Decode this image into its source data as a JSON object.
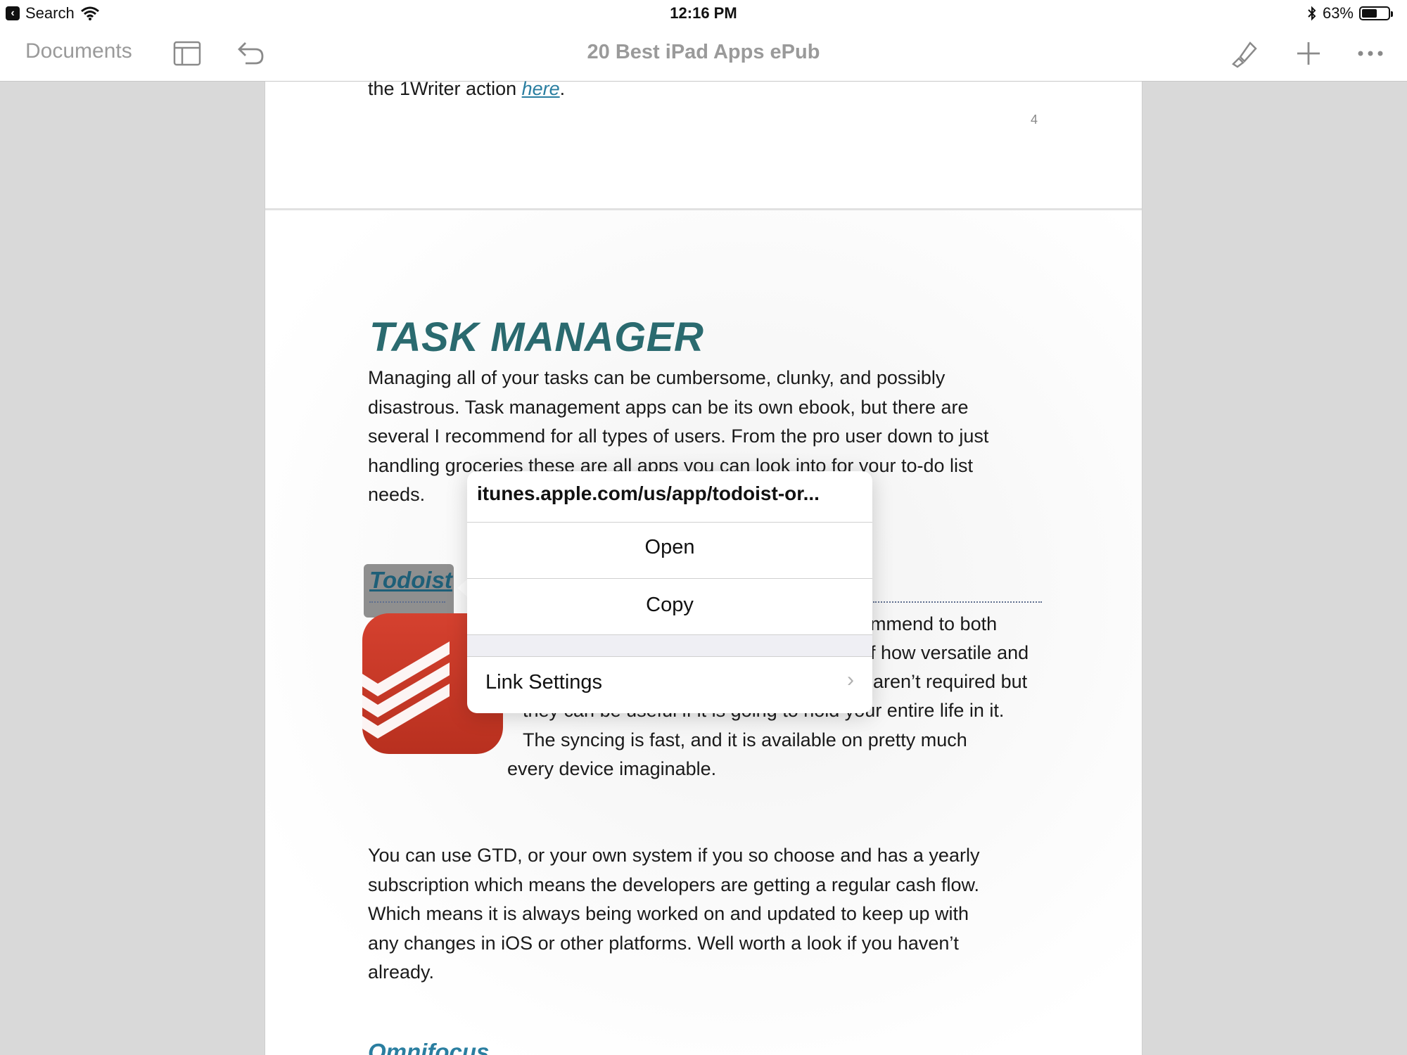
{
  "status_bar": {
    "back_label": "Search",
    "time": "12:16 PM",
    "battery": "63%",
    "battery_level": 0.63
  },
  "toolbar": {
    "documents_label": "Documents",
    "title": "20 Best iPad Apps ePub"
  },
  "document": {
    "prev_page": {
      "text_before_link": "the 1Writer action ",
      "link_text": "here",
      "text_after_link": ".",
      "page_number": "4"
    },
    "heading": "TASK MANAGER",
    "intro_lines": [
      "Managing all of your tasks can be cumbersome, clunky, and possibly",
      "disastrous. Task management apps can be its own ebook, but there are",
      "several I recommend for all types of users. From the pro user down to just",
      "handling groceries these are all apps you can look into for your to-do list",
      "needs."
    ],
    "section_title": "Todoist",
    "todoist_fragments": [
      "mmend to both",
      "f how versatile and",
      "aren’t required but",
      "they can be useful if it is going to hold your entire life in it.",
      "The syncing is fast, and it is available on pretty much",
      "every device imaginable."
    ],
    "paragraph2_lines": [
      "You can use GTD, or your own system if you so choose and has a yearly",
      "subscription which means the developers are getting a regular cash flow.",
      "Which means it is always being worked on and updated to keep up with",
      "any changes in iOS or other platforms. Well worth a look if you haven’t",
      "already."
    ],
    "next_section_partial": "Omnifocus"
  },
  "popover": {
    "url": "itunes.apple.com/us/app/todoist-or...",
    "open_label": "Open",
    "copy_label": "Copy",
    "settings_label": "Link Settings"
  },
  "colors": {
    "heading": "#2a6a6f",
    "link": "#2a7ea0",
    "icon_red": "#c8372a"
  }
}
